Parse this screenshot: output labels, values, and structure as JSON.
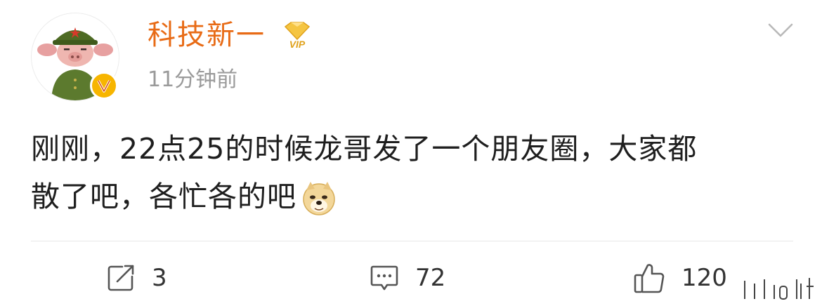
{
  "post": {
    "username": "科技新一",
    "vip_badge_text": "VIP",
    "timestamp": "11分钟前",
    "content_line1": "刚刚，22点25的时候龙哥发了一个朋友圈，大家都",
    "content_line2": "散了吧，各忙各的吧",
    "emoji": "doge-emoji"
  },
  "actions": {
    "repost_count": "3",
    "comment_count": "72",
    "like_count": "120"
  },
  "icons": {
    "menu": "chevron-down-icon",
    "repost": "repost-icon",
    "comment": "comment-icon",
    "like": "thumbs-up-icon"
  },
  "colors": {
    "username": "#e86b16",
    "verified": "#f7b500",
    "timestamp": "#9a9a9a",
    "text": "#1e1e1e"
  }
}
